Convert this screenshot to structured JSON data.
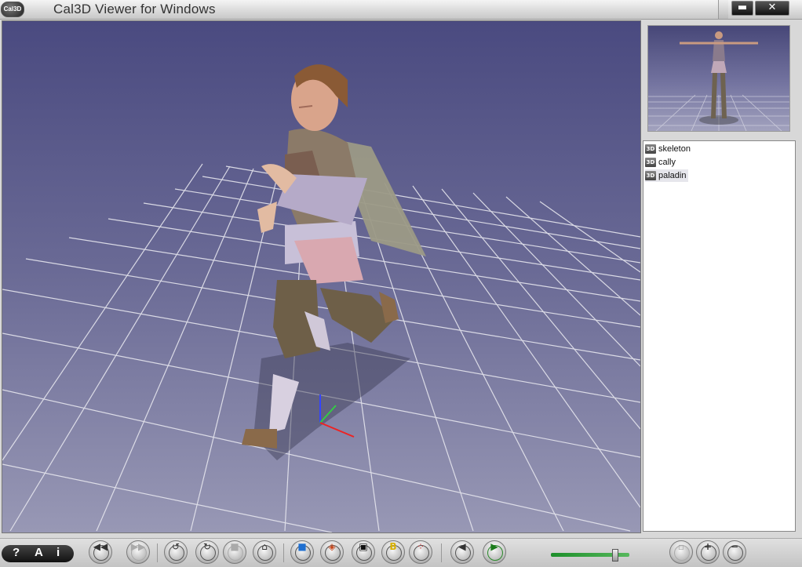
{
  "window": {
    "title": "Cal3D Viewer for Windows",
    "logo_text": "Cal3D",
    "minimize_label": "▬",
    "close_label": "✕"
  },
  "tree": {
    "items": [
      {
        "badge": "3D",
        "label": "skeleton"
      },
      {
        "badge": "3D",
        "label": "cally"
      },
      {
        "badge": "3D",
        "label": "paladin",
        "selected": true
      }
    ]
  },
  "toolbar": {
    "help_labels": [
      "?",
      "A",
      "i"
    ],
    "buttons": [
      {
        "name": "rewind-icon",
        "glyph": "◀◀"
      },
      {
        "name": "fast-forward-icon",
        "glyph": "▶▶"
      },
      {
        "name": "rotate-left-icon",
        "glyph": "↺"
      },
      {
        "name": "rotate-right-icon",
        "glyph": "↻"
      },
      {
        "name": "stop-icon",
        "glyph": "■"
      },
      {
        "name": "home-icon",
        "glyph": "⌂"
      },
      {
        "name": "solid-view-icon",
        "glyph": "■"
      },
      {
        "name": "wireframe-view-icon",
        "glyph": "◈"
      },
      {
        "name": "bounding-box-icon",
        "glyph": "▣"
      },
      {
        "name": "bones-view-icon",
        "glyph": "B"
      },
      {
        "name": "points-view-icon",
        "glyph": "⁘"
      },
      {
        "name": "previous-icon",
        "glyph": "◀"
      },
      {
        "name": "play-icon",
        "glyph": "▶"
      },
      {
        "name": "disk-icon",
        "glyph": "▫"
      },
      {
        "name": "zoom-in-icon",
        "glyph": "+"
      },
      {
        "name": "zoom-out-icon",
        "glyph": "−"
      }
    ],
    "speed_slider_value": 0.78
  }
}
